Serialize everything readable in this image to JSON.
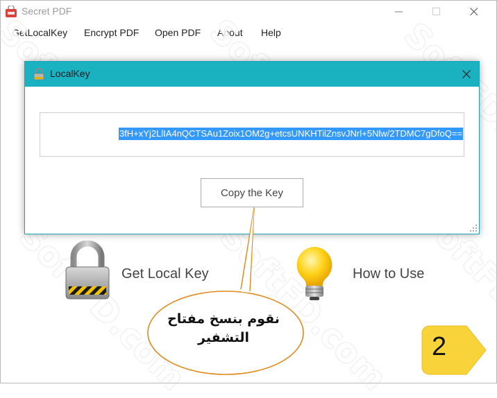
{
  "window": {
    "title": "Secret PDF"
  },
  "menu": [
    "GetLocalKey",
    "Encrypt PDF",
    "Open PDF",
    "About",
    "Help"
  ],
  "dialog": {
    "title": "LocalKey",
    "key_value": "3fH+xYj2LlIA4nQCTSAu1Zoix1OM2g+etcsUNKHTilZnsvJNrl+5Nlw/2TDMC7gDfoQ==",
    "copy_button": "Copy the Key"
  },
  "features": {
    "get_local_key": "Get Local Key",
    "how_to_use": "How to Use"
  },
  "callout": {
    "line1": "نقوم بنسخ مفتاح",
    "line2": "التشفير"
  },
  "step": {
    "number": "2"
  },
  "watermark": {
    "text": "SoftFD.com"
  },
  "colors": {
    "dialog_titlebar": "#1ab2c1",
    "selection": "#3399ff",
    "callout_stroke": "#e08a1e",
    "badge_fill": "#f8d43a"
  },
  "icons": {
    "app": "pdf-lock-icon",
    "dialog": "padlock-icon",
    "get_local_key": "padlock-icon",
    "how_to_use": "lightbulb-icon"
  }
}
